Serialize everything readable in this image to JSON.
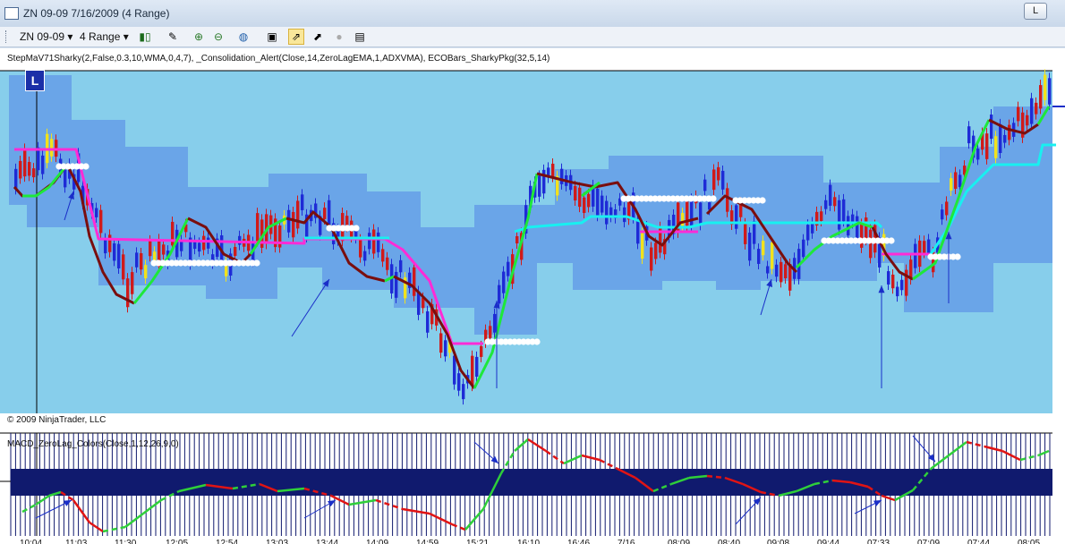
{
  "window": {
    "title": "ZN 09-09  7/16/2009 (4 Range)",
    "restore_label": "L"
  },
  "toolbar": {
    "instrument": "ZN 09-09",
    "period": "4 Range",
    "icons": [
      "candlestick-icon",
      "pencil-icon",
      "zoom-in-icon",
      "zoom-out-icon",
      "globe-icon",
      "properties-icon",
      "strategy-icon",
      "chart-trader-icon",
      "circle-icon",
      "data-box-icon"
    ]
  },
  "price_panel": {
    "indicator_label": "StepMaV71Sharky(2,False,0.3,10,WMA,0,4,7), _Consolidation_Alert(Close,14,ZeroLagEMA,1,ADXVMA), ECOBars_SharkyPkg(32,5,14)",
    "copyright": "© 2009 NinjaTrader, LLC",
    "marker_label": "L"
  },
  "macd_panel": {
    "indicator_label": "MACD_ZeroLag_Colors(Close,1,12,26,9,0)"
  },
  "colors": {
    "background": "#87ceeb",
    "band": "#6aa5e8",
    "up_bar": "#1e2bd6",
    "down_bar": "#d01a1a",
    "neutral_bar": "#f2e21c",
    "trail_magenta": "#ff2bd6",
    "trail_cyan": "#18f0f0",
    "ma_up": "#1ee83a",
    "ma_down": "#7a0e0e",
    "macd_block": "#101a6e"
  },
  "x_axis": {
    "labels": [
      "10:04",
      "11:03",
      "11:30",
      "12:05",
      "12:54",
      "13:03",
      "13:44",
      "14:09",
      "14:59",
      "15:21",
      "16:10",
      "16:46",
      "7/16",
      "08:09",
      "08:40",
      "09:08",
      "09:44",
      "07:33",
      "07:09",
      "07:44",
      "08:05"
    ]
  }
}
